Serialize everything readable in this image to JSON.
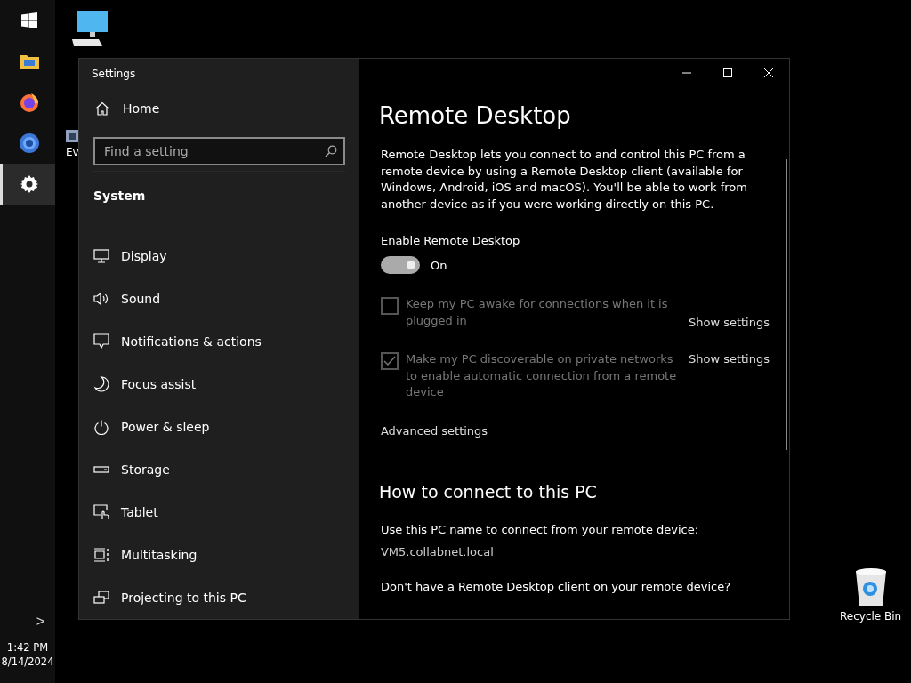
{
  "taskbar": {
    "apps": [
      {
        "kind": "start",
        "selected": false
      },
      {
        "kind": "explorer",
        "selected": false
      },
      {
        "kind": "firefox",
        "selected": false
      },
      {
        "kind": "chrome",
        "selected": false
      },
      {
        "kind": "settings",
        "selected": true
      }
    ],
    "expand": ">",
    "time": "1:42 PM",
    "date": "8/14/2024"
  },
  "desktop": {
    "icons": [
      {
        "kind": "pc"
      },
      {
        "kind": "shortcut",
        "label": "Ev"
      },
      {
        "kind": "recycle",
        "label": "Recycle Bin"
      }
    ]
  },
  "window": {
    "title": "Settings"
  },
  "sidebar": {
    "home": "Home",
    "search": {
      "placeholder": "Find a setting"
    },
    "section": "System",
    "items": [
      {
        "kind": "display",
        "label": "Display",
        "selected": false
      },
      {
        "kind": "sound",
        "label": "Sound",
        "selected": false
      },
      {
        "kind": "notifications",
        "label": "Notifications & actions",
        "selected": false
      },
      {
        "kind": "focus",
        "label": "Focus assist",
        "selected": false
      },
      {
        "kind": "power",
        "label": "Power & sleep",
        "selected": false
      },
      {
        "kind": "storage",
        "label": "Storage",
        "selected": false
      },
      {
        "kind": "tablet",
        "label": "Tablet",
        "selected": false
      },
      {
        "kind": "multitasking",
        "label": "Multitasking",
        "selected": false
      },
      {
        "kind": "projecting",
        "label": "Projecting to this PC",
        "selected": false
      }
    ]
  },
  "content": {
    "title": "Remote Desktop",
    "description": "Remote Desktop lets you connect to and control this PC from a remote device by using a Remote Desktop client (available for Windows, Android, iOS and macOS). You'll be able to work from another device as if you were working directly on this PC.",
    "toggle": {
      "label": "Enable Remote Desktop",
      "on": true,
      "disabled": true,
      "state_text": "On"
    },
    "options": [
      {
        "label": "Keep my PC awake for connections when it is plugged in",
        "checked": false,
        "disabled": true,
        "link": "Show settings"
      },
      {
        "label": "Make my PC discoverable on private networks to enable automatic connection from a remote device",
        "checked": true,
        "disabled": true,
        "link": "Show settings"
      }
    ],
    "advanced_link": "Advanced settings",
    "connect_heading": "How to connect to this PC",
    "connect_label": "Use this PC name to connect from your remote device:",
    "pc_name": "VM5.collabnet.local",
    "client_question": "Don't have a Remote Desktop client on your remote device?"
  }
}
